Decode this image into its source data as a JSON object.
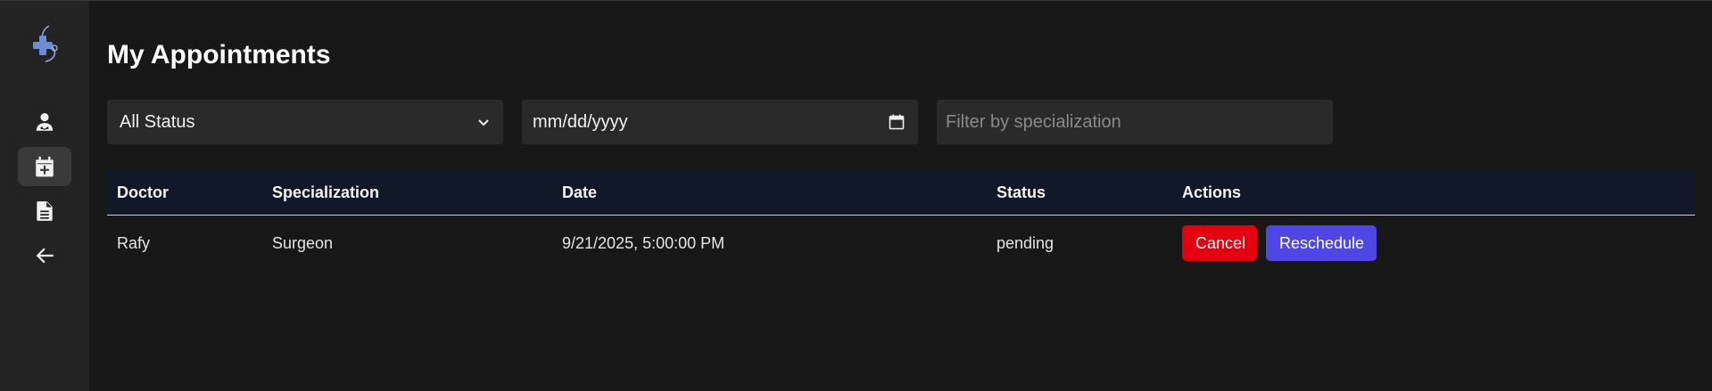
{
  "page": {
    "title": "My Appointments"
  },
  "sidebar": {
    "items": [
      {
        "icon": "doctor-icon",
        "active": false
      },
      {
        "icon": "calendar-plus-icon",
        "active": true
      },
      {
        "icon": "document-icon",
        "active": false
      },
      {
        "icon": "arrow-left-icon",
        "active": false
      }
    ]
  },
  "filters": {
    "status": {
      "selected": "All Status"
    },
    "date": {
      "value": "mm/dd/yyyy"
    },
    "specialization": {
      "placeholder": "Filter by specialization",
      "value": ""
    }
  },
  "table": {
    "headers": [
      "Doctor",
      "Specialization",
      "Date",
      "Status",
      "Actions"
    ],
    "rows": [
      {
        "doctor": "Rafy",
        "specialization": "Surgeon",
        "date": "9/21/2025, 5:00:00 PM",
        "status": "pending",
        "actions": {
          "cancel": "Cancel",
          "reschedule": "Reschedule"
        }
      }
    ]
  },
  "colors": {
    "background": "#181818",
    "sidebar": "#232323",
    "header_row": "#111827",
    "cancel": "#e5010f",
    "reschedule": "#4f46e5",
    "logo_accent": "#6b8dd6"
  }
}
